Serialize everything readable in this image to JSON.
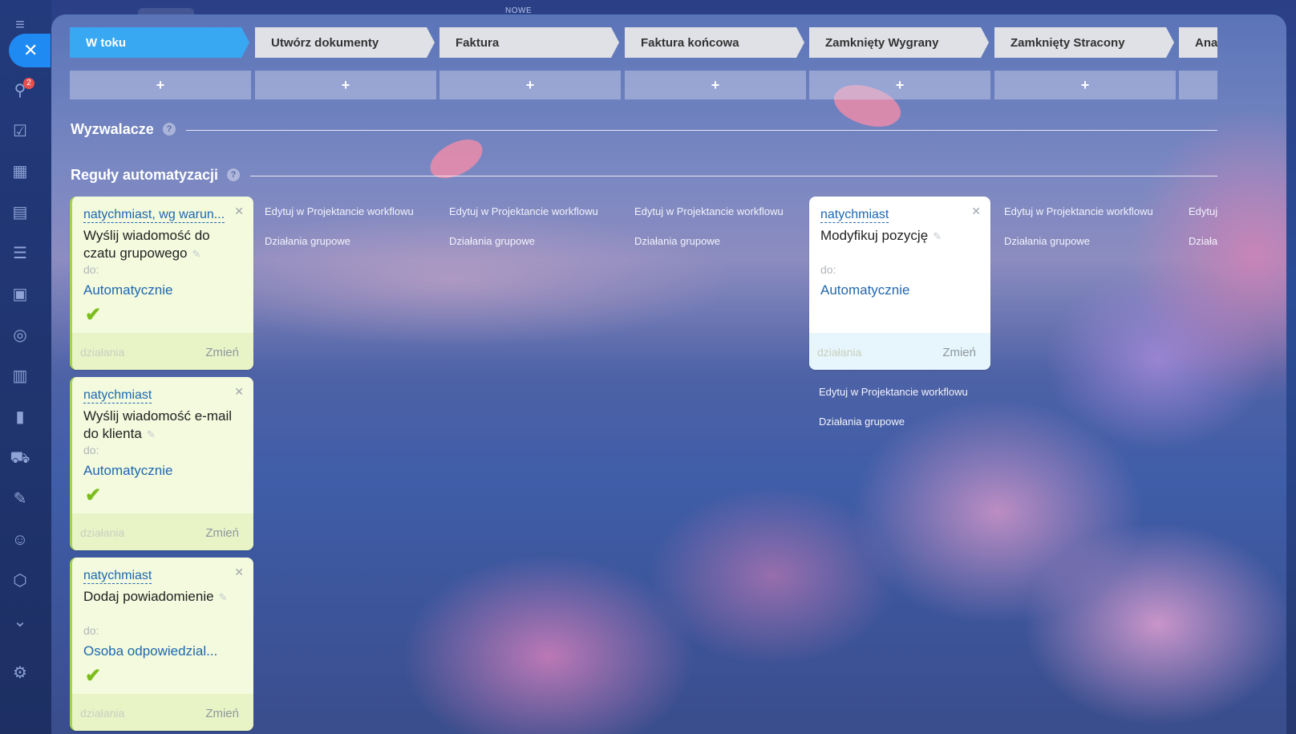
{
  "top_label": "NOWE",
  "sidebar": {
    "badge": "2",
    "icons": [
      "menu-icon",
      "close-icon",
      "pipeline-icon",
      "tasks-icon",
      "calendar-icon",
      "contacts-icon",
      "funnel-icon",
      "store-icon",
      "target-icon",
      "planner-icon",
      "analytics-icon",
      "cart-icon",
      "signature-icon",
      "robot-icon",
      "box-icon",
      "chevron-down-icon",
      "settings-icon"
    ]
  },
  "stages": [
    "W toku",
    "Utwórz dokumenty",
    "Faktura",
    "Faktura końcowa",
    "Zamknięty Wygrany",
    "Zamknięty Stracony",
    "Ana"
  ],
  "add_label": "+",
  "sections": {
    "triggers": "Wyzwalacze",
    "rules": "Reguły automatyzacji",
    "help": "?"
  },
  "links": {
    "edit": "Edytuj w Projektancie workflowu",
    "edit_short": "Edytuj",
    "group": "Działania grupowe",
    "group_short": "Działa"
  },
  "cards": [
    {
      "when": "natychmiast, wg warun...",
      "title": "Wyślij wiadomość do czatu grupowego",
      "to": "do:",
      "resp": "Automatycznie",
      "actions": "działania",
      "change": "Zmień"
    },
    {
      "when": "natychmiast",
      "title": "Wyślij wiadomość e-mail do klienta",
      "to": "do:",
      "resp": "Automatycznie",
      "actions": "działania",
      "change": "Zmień"
    },
    {
      "when": "natychmiast",
      "title": "Dodaj powiadomienie",
      "to": "do:",
      "resp": "Osoba odpowiedzial...",
      "actions": "działania",
      "change": "Zmień"
    },
    {
      "when": "natychmiast",
      "title": "Modyfikuj pozycję",
      "to": "do:",
      "resp": "Automatycznie",
      "actions": "działania",
      "change": "Zmień"
    }
  ],
  "colors": {
    "accent": "#38a8f3",
    "link": "#2067b0",
    "check": "#7cbd1e",
    "card": "#f3fadd"
  }
}
